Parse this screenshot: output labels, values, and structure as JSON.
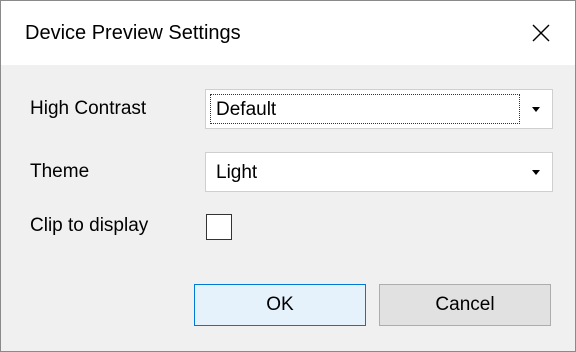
{
  "dialog": {
    "title": "Device Preview Settings"
  },
  "fields": {
    "high_contrast_label": "High Contrast",
    "high_contrast_value": "Default",
    "theme_label": "Theme",
    "theme_value": "Light",
    "clip_label": "Clip to display",
    "clip_checked": false
  },
  "buttons": {
    "ok_label": "OK",
    "cancel_label": "Cancel"
  },
  "icons": {
    "close": "close-icon",
    "dropdown": "chevron-down-icon"
  },
  "colors": {
    "dialog_background": "#f0f0f0",
    "title_background": "#ffffff",
    "default_button_border": "#0078d7",
    "default_button_fill": "#e5f1fb",
    "button_fill": "#e1e1e1"
  }
}
